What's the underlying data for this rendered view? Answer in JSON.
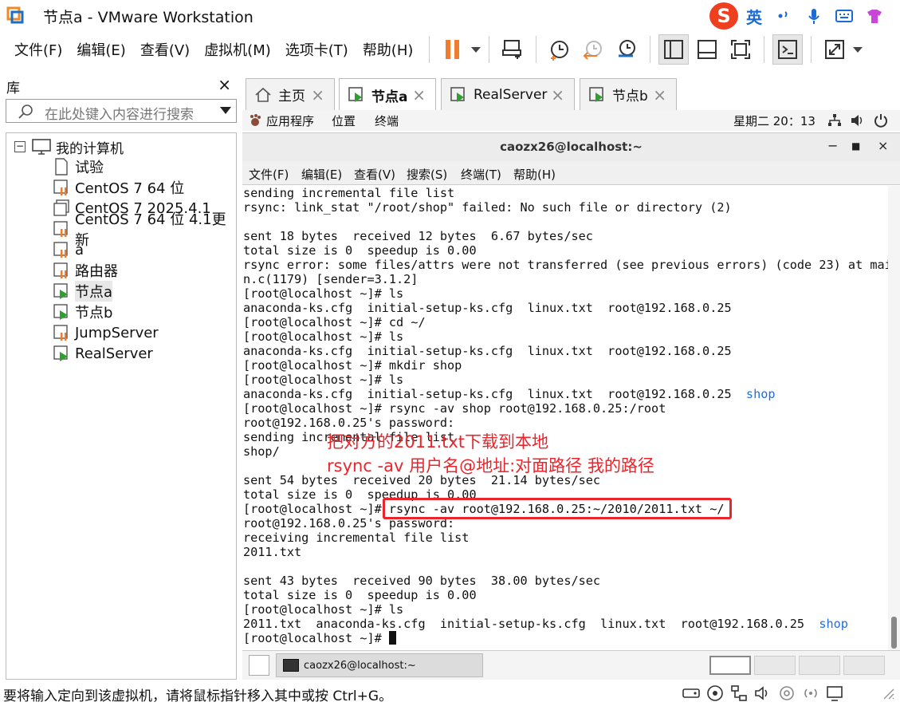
{
  "window": {
    "title": "节点a - VMware Workstation"
  },
  "ime": {
    "mode": "英"
  },
  "menu": [
    "文件(F)",
    "编辑(E)",
    "查看(V)",
    "虚拟机(M)",
    "选项卡(T)",
    "帮助(H)"
  ],
  "library": {
    "title": "库",
    "close": "×",
    "search_placeholder": "在此处键入内容进行搜索",
    "root": "我的计算机",
    "items": [
      {
        "label": "试验",
        "state": "document"
      },
      {
        "label": "CentOS 7 64 位",
        "state": "off"
      },
      {
        "label": "CentOS 7 2025.4.1",
        "state": "clone"
      },
      {
        "label": "CentOS 7 64 位 4.1更新",
        "state": "off"
      },
      {
        "label": "a",
        "state": "off"
      },
      {
        "label": "路由器",
        "state": "off"
      },
      {
        "label": "节点a",
        "state": "running"
      },
      {
        "label": "节点b",
        "state": "running"
      },
      {
        "label": "JumpServer",
        "state": "off"
      },
      {
        "label": "RealServer",
        "state": "running"
      }
    ]
  },
  "tabs": [
    {
      "label": "主页",
      "active": false
    },
    {
      "label": "节点a",
      "active": true
    },
    {
      "label": "RealServer",
      "active": false
    },
    {
      "label": "节点b",
      "active": false
    }
  ],
  "gnome": {
    "applications": "应用程序",
    "places": "位置",
    "terminal": "终端",
    "clock": "星期二 20：13"
  },
  "terminal_window": {
    "title": "caozx26@localhost:~",
    "menu": [
      "文件(F)",
      "编辑(E)",
      "查看(V)",
      "搜索(S)",
      "终端(T)",
      "帮助(H)"
    ]
  },
  "terminal_lines": [
    "sending incremental file list",
    "rsync: link_stat \"/root/shop\" failed: No such file or directory (2)",
    "",
    "sent 18 bytes  received 12 bytes  6.67 bytes/sec",
    "total size is 0  speedup is 0.00",
    "rsync error: some files/attrs were not transferred (see previous errors) (code 23) at mai",
    "n.c(1179) [sender=3.1.2]",
    "[root@localhost ~]# ls",
    "anaconda-ks.cfg  initial-setup-ks.cfg  linux.txt  root@192.168.0.25",
    "[root@localhost ~]# cd ~/",
    "[root@localhost ~]# ls",
    "anaconda-ks.cfg  initial-setup-ks.cfg  linux.txt  root@192.168.0.25",
    "[root@localhost ~]# mkdir shop",
    "[root@localhost ~]# ls",
    "anaconda-ks.cfg  initial-setup-ks.cfg  linux.txt  root@192.168.0.25  ",
    "[root@localhost ~]# rsync -av shop root@192.168.0.25:/root",
    "root@192.168.0.25's password:",
    "sending incremental file list",
    "shop/",
    "",
    "sent 54 bytes  received 20 bytes  21.14 bytes/sec",
    "total size is 0  speedup is 0.00",
    "[root@localhost ~]# rsync -av root@192.168.0.25:~/2010/2011.txt ~/",
    "root@192.168.0.25's password:",
    "receiving incremental file list",
    "2011.txt",
    "",
    "sent 43 bytes  received 90 bytes  38.00 bytes/sec",
    "total size is 0  speedup is 0.00",
    "[root@localhost ~]# ls",
    "2011.txt  anaconda-ks.cfg  initial-setup-ks.cfg  linux.txt  root@192.168.0.25  ",
    "[root@localhost ~]# "
  ],
  "dir_entry": "shop",
  "annotations": {
    "line1": "把对方的2011.txt下载到本地",
    "line2": "rsync -av 用户名@地址:对面路径 我的路径"
  },
  "taskbar": {
    "window": "caozx26@localhost:~"
  },
  "status": {
    "message": "要将输入定向到该虚拟机，请将鼠标指针移入其中或按 Ctrl+G。"
  },
  "colors": {
    "accent_red": "#e8262c",
    "dir_blue": "#1f6fe0",
    "pause_orange": "#f07d2e"
  }
}
